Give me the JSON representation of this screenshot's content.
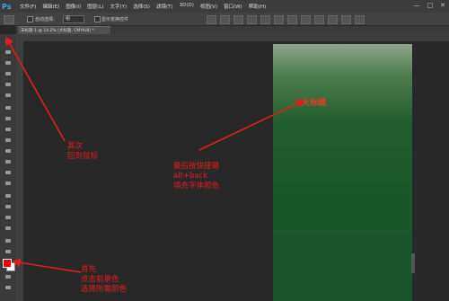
{
  "app": {
    "logo": "Ps"
  },
  "menu": [
    "文件(F)",
    "编辑(E)",
    "图像(I)",
    "图层(L)",
    "文字(Y)",
    "选择(S)",
    "滤镜(T)",
    "3D(D)",
    "视图(V)",
    "窗口(W)",
    "帮助(H)"
  ],
  "window_controls": [
    "—",
    "□",
    "✕"
  ],
  "options": {
    "auto_select_label": "自动选择:",
    "auto_select_value": "组",
    "show_transform_label": "显示变换控件"
  },
  "document": {
    "tab_title": "未标题-1 @ 14.2% (大标题, CMYK/8) *",
    "canvas_text": "大标题"
  },
  "colors": {
    "accent": "#e51c1c",
    "foreground": "#e60000",
    "background": "#ffffff"
  },
  "annotations": {
    "second": [
      "其次",
      "回到鼠标"
    ],
    "last": [
      "最后按快捷键",
      "alt+back",
      "填充字体颜色"
    ],
    "first": [
      "首先",
      "点击前景色",
      "选择所需颜色"
    ]
  }
}
